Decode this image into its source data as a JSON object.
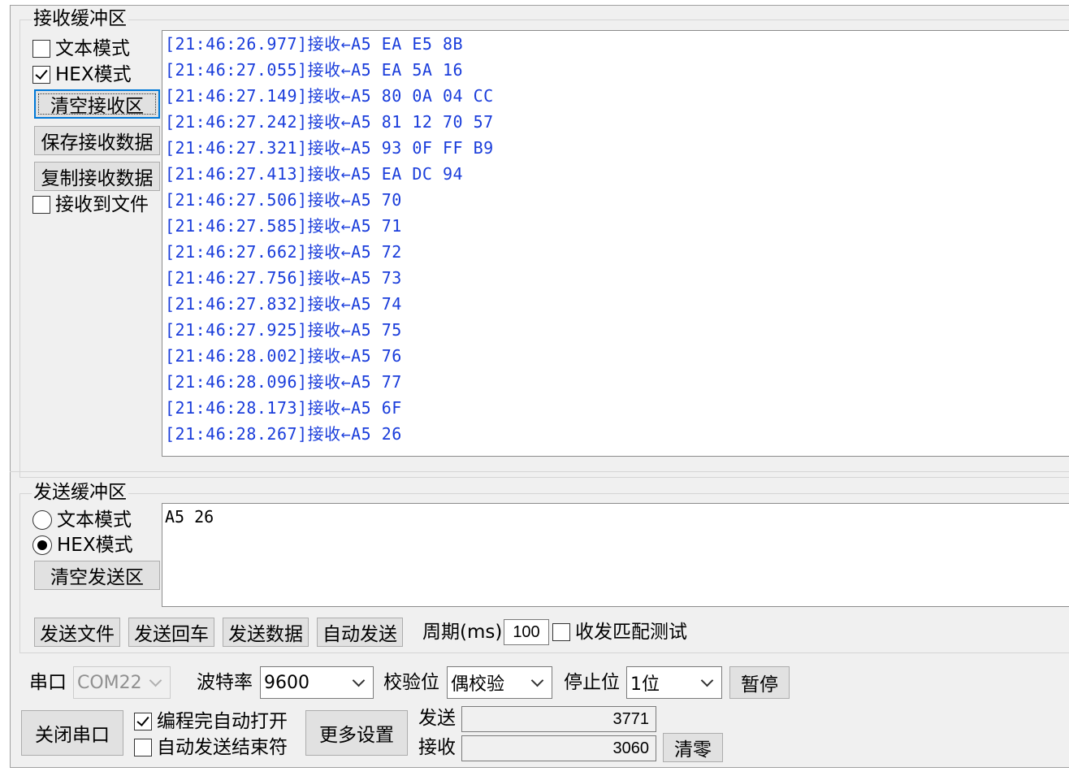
{
  "receive": {
    "legend": "接收缓冲区",
    "text_mode": "文本模式",
    "hex_mode": "HEX模式",
    "clear_btn": "清空接收区",
    "save_btn": "保存接收数据",
    "copy_btn": "复制接收数据",
    "to_file": "接收到文件",
    "lines": [
      "[21:46:26.977]接收←A5 EA E5 8B",
      "[21:46:27.055]接收←A5 EA 5A 16",
      "[21:46:27.149]接收←A5 80 0A 04 CC",
      "[21:46:27.242]接收←A5 81 12 70 57",
      "[21:46:27.321]接收←A5 93 0F FF B9",
      "[21:46:27.413]接收←A5 EA DC 94",
      "[21:46:27.506]接收←A5 70",
      "[21:46:27.585]接收←A5 71",
      "[21:46:27.662]接收←A5 72",
      "[21:46:27.756]接收←A5 73",
      "[21:46:27.832]接收←A5 74",
      "[21:46:27.925]接收←A5 75",
      "[21:46:28.002]接收←A5 76",
      "[21:46:28.096]接收←A5 77",
      "[21:46:28.173]接收←A5 6F",
      "[21:46:28.267]接收←A5 26"
    ]
  },
  "send": {
    "legend": "发送缓冲区",
    "text_mode": "文本模式",
    "hex_mode": "HEX模式",
    "clear_btn": "清空发送区",
    "content": "A5 26",
    "file_btn": "发送文件",
    "enter_btn": "发送回车",
    "data_btn": "发送数据",
    "auto_btn": "自动发送",
    "period_label": "周期(ms)",
    "period_value": "100",
    "match_test": "收发匹配测试"
  },
  "port": {
    "port_label": "串口",
    "port_value": "COM22",
    "baud_label": "波特率",
    "baud_value": "9600",
    "parity_label": "校验位",
    "parity_value": "偶校验",
    "stop_label": "停止位",
    "stop_value": "1位",
    "pause_btn": "暂停",
    "close_btn": "关闭串口",
    "auto_open": "编程完自动打开",
    "auto_end": "自动发送结束符",
    "more_btn": "更多设置",
    "send_label": "发送",
    "send_count": "3771",
    "recv_label": "接收",
    "recv_count": "3060",
    "clear_count_btn": "清零"
  }
}
